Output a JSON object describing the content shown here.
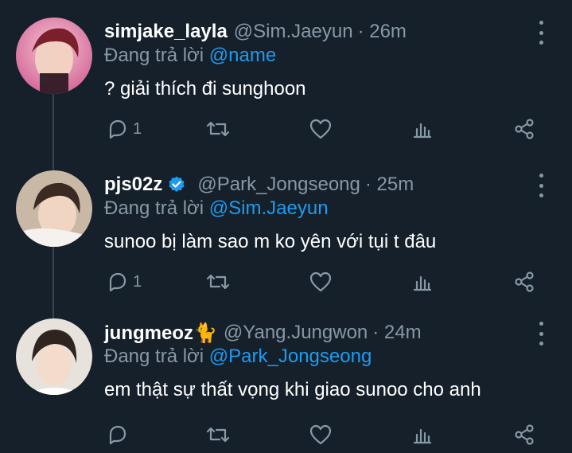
{
  "colors": {
    "background": "#15202b",
    "muted": "#8899a6",
    "accent": "#1d9bf0",
    "divider": "#38444d",
    "verified": "#1d9bf0"
  },
  "tweets": [
    {
      "display_name": "simjake_layla",
      "handle": "@Sim.Jaeyun",
      "time": "· 26m",
      "reply_prefix": "Đang trả lời",
      "reply_to": "@name",
      "text": "? giải thích đi sunghoon",
      "reply_count": "1",
      "verified": false
    },
    {
      "display_name": "pjs02z",
      "handle": "@Park_Jongseong",
      "time": "· 25m",
      "reply_prefix": "Đang trả lời",
      "reply_to": "@Sim.Jaeyun",
      "text": "sunoo bị làm sao m ko yên với tụi t đâu",
      "reply_count": "1",
      "verified": true
    },
    {
      "display_name": "jungmeoz🐈",
      "handle": "@Yang.Jungwon",
      "time": "· 24m",
      "reply_prefix": "Đang trả lời",
      "reply_to": "@Park_Jongseong",
      "text": "em thật sự thất vọng khi giao sunoo cho anh",
      "reply_count": "",
      "verified": false
    }
  ],
  "icons": {
    "reply": "reply-icon",
    "retweet": "retweet-icon",
    "like": "heart-icon",
    "views": "analytics-icon",
    "share": "share-icon",
    "more": "more-options-icon",
    "verified": "verified-badge-icon"
  }
}
